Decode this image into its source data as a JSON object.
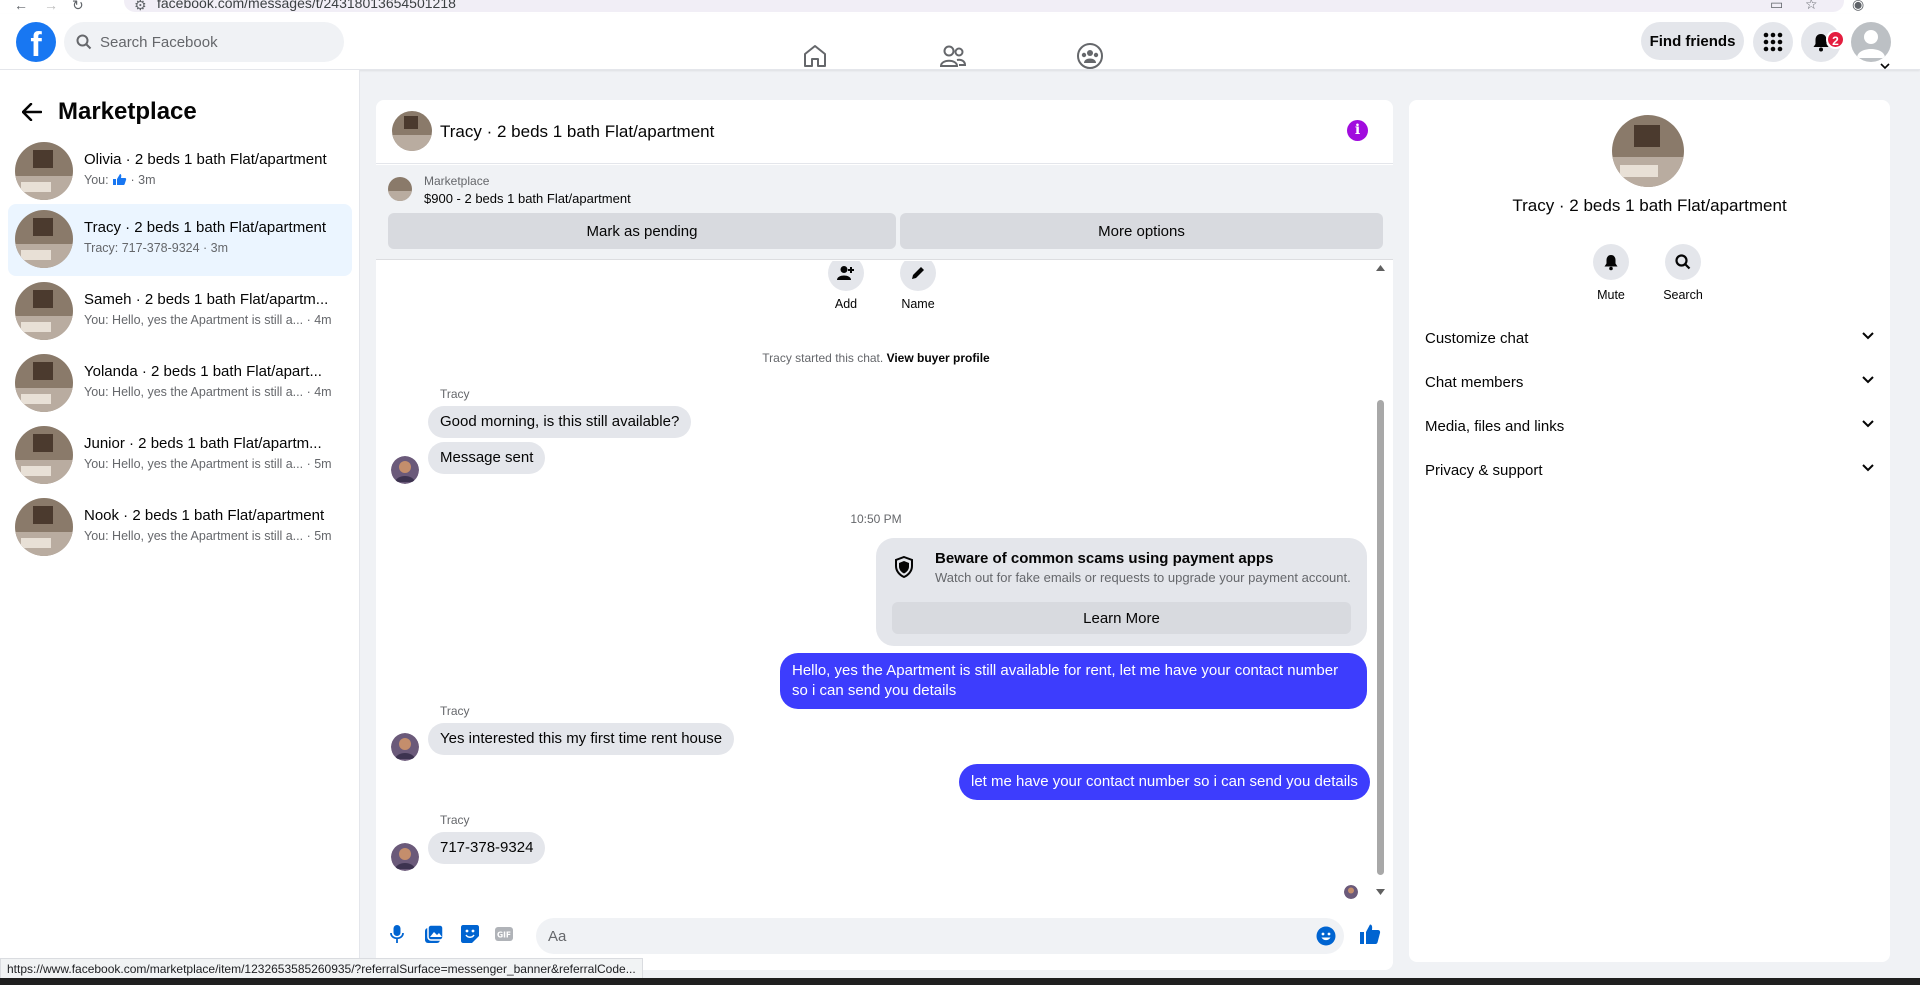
{
  "browser": {
    "url": "facebook.com/messages/t/24318013654501218"
  },
  "topbar": {
    "logo": "f",
    "search_placeholder": "Search Facebook",
    "find_friends": "Find friends",
    "notification_count": "2",
    "icons": [
      "home-icon",
      "friends-icon",
      "groups-icon",
      "menu-grid-icon",
      "bell-icon",
      "profile-icon"
    ]
  },
  "sidebar": {
    "title": "Marketplace",
    "conversations": [
      {
        "name": "Olivia · 2 beds 1 bath Flat/apartment",
        "preview_prefix": "You: ",
        "preview_suffix": " · 3m",
        "has_like": true
      },
      {
        "name": "Tracy · 2 beds 1 bath Flat/apartment",
        "preview": "Tracy: 717-378-9324 · 3m",
        "active": true
      },
      {
        "name": "Sameh · 2 beds 1 bath Flat/apartm...",
        "preview": "You: Hello, yes the Apartment is still a... · 4m"
      },
      {
        "name": "Yolanda · 2 beds 1 bath Flat/apart...",
        "preview": "You: Hello, yes the Apartment is still a... · 4m"
      },
      {
        "name": "Junior · 2 beds 1 bath Flat/apartm...",
        "preview": "You: Hello, yes the Apartment is still a... · 5m"
      },
      {
        "name": "Nook · 2 beds 1 bath Flat/apartment",
        "preview": "You: Hello, yes the Apartment is still a... · 5m"
      }
    ]
  },
  "chat": {
    "title": "Tracy · 2 beds 1 bath Flat/apartment",
    "banner": {
      "label": "Marketplace",
      "listing": "$900 - 2 beds 1 bath Flat/apartment",
      "pending_btn": "Mark as pending",
      "more_btn": "More options"
    },
    "top_actions": {
      "add": "Add",
      "name": "Name"
    },
    "started_text": "Tracy started this chat.",
    "view_profile": "View buyer profile",
    "sender": "Tracy",
    "messages": {
      "m1": "Good morning, is this still available?",
      "m2": "Message sent",
      "time": "10:50 PM",
      "out1": "Hello, yes the Apartment is still available for rent, let me have your contact number so i can send you details",
      "m3": "Yes interested this my first time rent house",
      "out2": "let me have your contact number so i can send you details",
      "m4": "717-378-9324"
    },
    "scam_notice": {
      "title": "Beware of common scams using payment apps",
      "subtitle": "Watch out for fake emails or requests to upgrade your payment account.",
      "button": "Learn More"
    },
    "composer_placeholder": "Aa"
  },
  "info_panel": {
    "name": "Tracy · 2 beds 1 bath Flat/apartment",
    "mute": "Mute",
    "search": "Search",
    "sections": [
      "Customize chat",
      "Chat members",
      "Media, files and links",
      "Privacy & support"
    ]
  },
  "status_url": "https://www.facebook.com/marketplace/item/1232653585260935/?referralSurface=messenger_banner&referralCode...",
  "colors": {
    "brand": "#1877f2",
    "outgoing": "#3d3dfd",
    "info": "#a10cde",
    "badge": "#e41e3f"
  }
}
